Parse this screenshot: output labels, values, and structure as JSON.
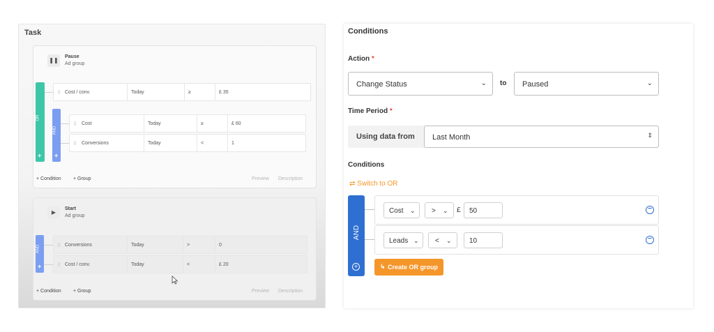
{
  "task": {
    "title": "Task",
    "card1": {
      "icon": "pause-icon",
      "title": "Pause",
      "subtitle": "Ad group",
      "or_label": "OR",
      "and_label": "AND",
      "rows": [
        {
          "metric": "Cost / conv.",
          "period": "Today",
          "op": "≥",
          "value": "£ 35"
        },
        {
          "metric": "Cost",
          "period": "Today",
          "op": "≥",
          "value": "£ 60"
        },
        {
          "metric": "Conversions",
          "period": "Today",
          "op": "<",
          "value": "1"
        }
      ],
      "add_condition": "+ Condition",
      "add_group": "+ Group",
      "preview": "Preview",
      "description": "Description"
    },
    "card2": {
      "icon": "play-icon",
      "title": "Start",
      "subtitle": "Ad group",
      "and_label": "AND",
      "rows": [
        {
          "metric": "Conversions",
          "period": "Today",
          "op": ">",
          "value": "0"
        },
        {
          "metric": "Cost / conv.",
          "period": "Today",
          "op": "<",
          "value": "£ 20"
        }
      ],
      "add_condition": "+ Condition",
      "add_group": "+ Group",
      "preview": "Preview",
      "description": "Description"
    }
  },
  "conditions_panel": {
    "title": "Conditions",
    "action_label": "Action",
    "required_mark": "*",
    "action_select": "Change Status",
    "to_label": "to",
    "status_select": "Paused",
    "time_period_label": "Time Period",
    "using_data_from": "Using data from",
    "period_select": "Last Month",
    "conditions_label": "Conditions",
    "switch_to_or": "Switch to OR",
    "and_label": "AND",
    "rows": [
      {
        "metric": "Cost",
        "op": ">",
        "currency": "£",
        "value": "50"
      },
      {
        "metric": "Leads",
        "op": "<",
        "currency": "",
        "value": "10"
      }
    ],
    "create_or_group": "Create OR group"
  },
  "colors": {
    "or_bar": "#3ec6a8",
    "and_bar_light": "#7c9ef0",
    "and_bar_dark": "#2f6fd1",
    "accent_orange": "#f5962a"
  }
}
